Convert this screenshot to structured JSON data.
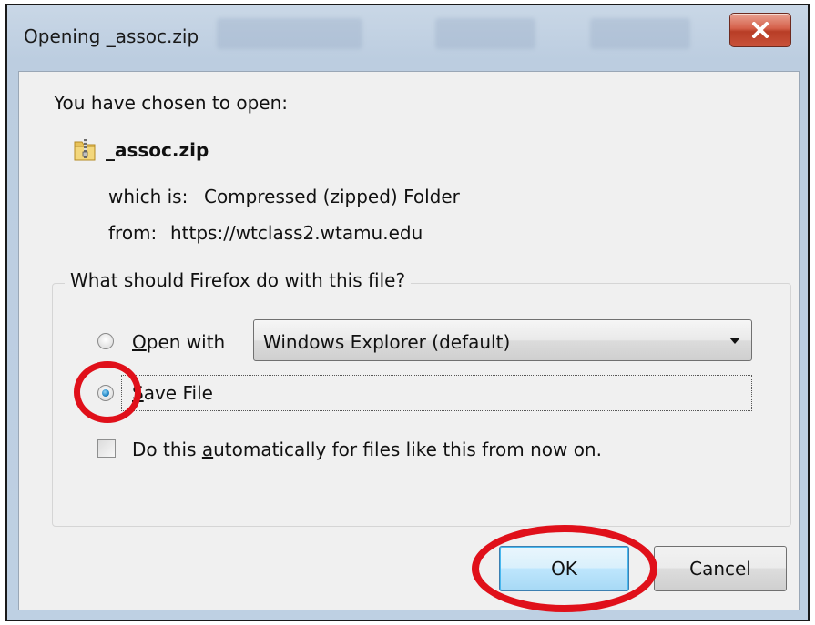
{
  "window": {
    "title": "Opening _assoc.zip",
    "close_glyph": "X"
  },
  "dialog": {
    "intro": "You have chosen to open:",
    "file_name": "_assoc.zip",
    "file_icon": "zip-folder-icon",
    "type_label": "which is:",
    "type_value": "Compressed (zipped) Folder",
    "from_label": "from:",
    "from_value": "https://wtclass2.wtamu.edu",
    "group_title": "What should Firefox do with this file?",
    "open_with_label": "Open with",
    "open_with_selected": "Windows Explorer (default)",
    "open_with_checked": false,
    "save_file_label": "Save File",
    "save_file_checked": true,
    "auto_label": "Do this automatically for files like this from now on.",
    "auto_checked": false
  },
  "buttons": {
    "ok": "OK",
    "cancel": "Cancel"
  },
  "annotations": {
    "highlight_color": "#e0101a",
    "highlighted": [
      "save-file-radio",
      "ok-button"
    ]
  }
}
